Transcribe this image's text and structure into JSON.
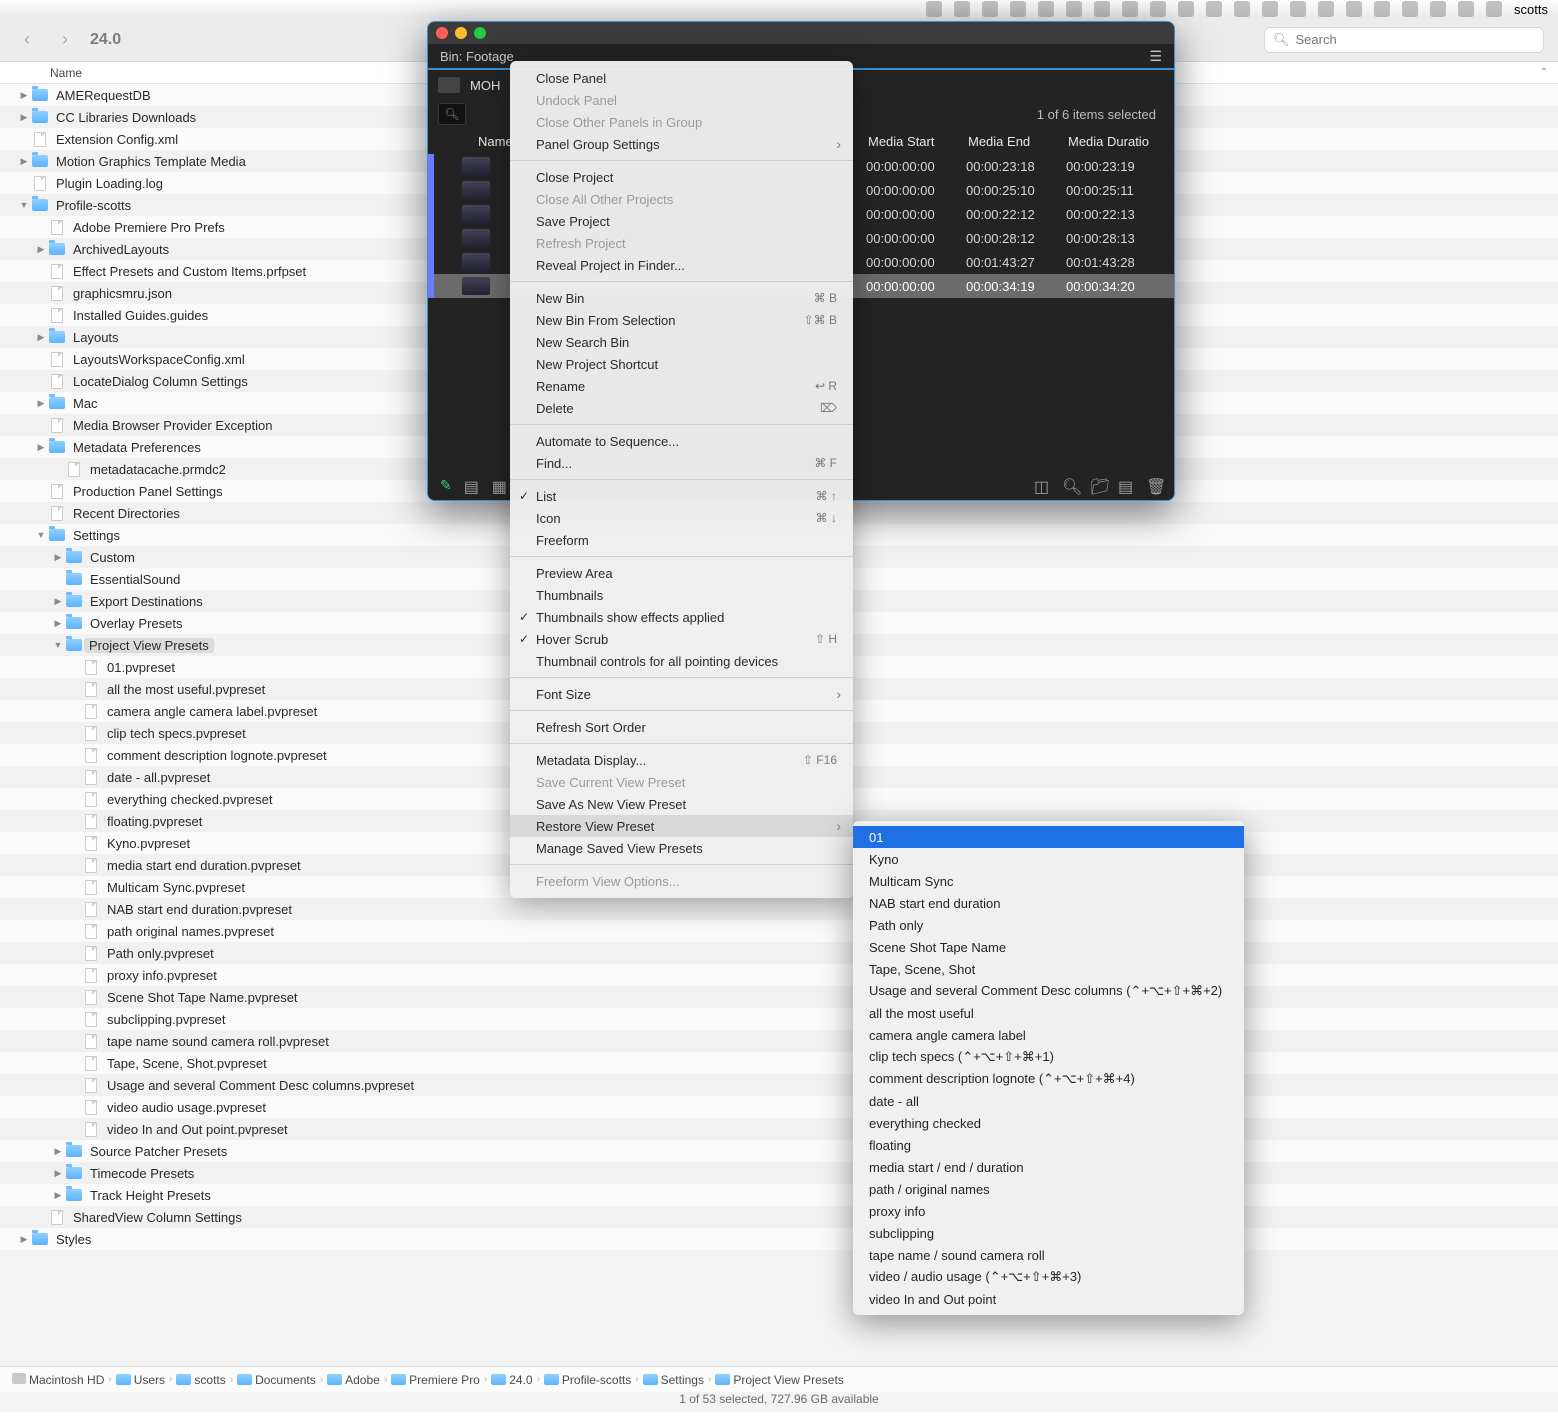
{
  "menubar": {
    "username": "scotts"
  },
  "toolbar": {
    "title": "24.0",
    "search_placeholder": "Search"
  },
  "column_header": "Name",
  "tree": [
    {
      "d": 0,
      "t": "folder",
      "a": "right",
      "label": "AMERequestDB"
    },
    {
      "d": 0,
      "t": "folder",
      "a": "right",
      "label": "CC Libraries Downloads"
    },
    {
      "d": 0,
      "t": "file",
      "label": "Extension Config.xml"
    },
    {
      "d": 0,
      "t": "folder",
      "a": "right",
      "label": "Motion Graphics Template Media"
    },
    {
      "d": 0,
      "t": "file",
      "label": "Plugin Loading.log"
    },
    {
      "d": 0,
      "t": "folder",
      "a": "down",
      "label": "Profile-scotts"
    },
    {
      "d": 1,
      "t": "file",
      "label": "Adobe Premiere Pro Prefs"
    },
    {
      "d": 1,
      "t": "folder",
      "a": "right",
      "label": "ArchivedLayouts"
    },
    {
      "d": 1,
      "t": "file",
      "label": "Effect Presets and Custom Items.prfpset"
    },
    {
      "d": 1,
      "t": "file",
      "label": "graphicsmru.json"
    },
    {
      "d": 1,
      "t": "file",
      "label": "Installed Guides.guides"
    },
    {
      "d": 1,
      "t": "folder",
      "a": "right",
      "label": "Layouts"
    },
    {
      "d": 1,
      "t": "file",
      "label": "LayoutsWorkspaceConfig.xml"
    },
    {
      "d": 1,
      "t": "file",
      "label": "LocateDialog Column Settings"
    },
    {
      "d": 1,
      "t": "folder",
      "a": "right",
      "label": "Mac"
    },
    {
      "d": 1,
      "t": "file",
      "label": "Media Browser Provider Exception"
    },
    {
      "d": 1,
      "t": "folder",
      "a": "right",
      "label": "Metadata Preferences"
    },
    {
      "d": 2,
      "t": "file",
      "label": "metadatacache.prmdc2"
    },
    {
      "d": 1,
      "t": "file",
      "label": "Production Panel Settings"
    },
    {
      "d": 1,
      "t": "file",
      "label": "Recent Directories"
    },
    {
      "d": 1,
      "t": "folder",
      "a": "down",
      "label": "Settings"
    },
    {
      "d": 2,
      "t": "folder",
      "a": "right",
      "label": "Custom"
    },
    {
      "d": 2,
      "t": "folder",
      "label": "EssentialSound"
    },
    {
      "d": 2,
      "t": "folder",
      "a": "right",
      "label": "Export Destinations"
    },
    {
      "d": 2,
      "t": "folder",
      "a": "right",
      "label": "Overlay Presets"
    },
    {
      "d": 2,
      "t": "folder",
      "a": "down",
      "label": "Project View Presets",
      "sel": true
    },
    {
      "d": 3,
      "t": "file",
      "label": "01.pvpreset"
    },
    {
      "d": 3,
      "t": "file",
      "label": "all the most useful.pvpreset"
    },
    {
      "d": 3,
      "t": "file",
      "label": "camera angle camera label.pvpreset"
    },
    {
      "d": 3,
      "t": "file",
      "label": "clip tech specs.pvpreset"
    },
    {
      "d": 3,
      "t": "file",
      "label": "comment description lognote.pvpreset"
    },
    {
      "d": 3,
      "t": "file",
      "label": "date - all.pvpreset"
    },
    {
      "d": 3,
      "t": "file",
      "label": "everything checked.pvpreset"
    },
    {
      "d": 3,
      "t": "file",
      "label": "floating.pvpreset"
    },
    {
      "d": 3,
      "t": "file",
      "label": "Kyno.pvpreset"
    },
    {
      "d": 3,
      "t": "file",
      "label": "media start  end  duration.pvpreset"
    },
    {
      "d": 3,
      "t": "file",
      "label": "Multicam Sync.pvpreset"
    },
    {
      "d": 3,
      "t": "file",
      "label": "NAB start end duration.pvpreset"
    },
    {
      "d": 3,
      "t": "file",
      "label": "path  original names.pvpreset"
    },
    {
      "d": 3,
      "t": "file",
      "label": "Path only.pvpreset"
    },
    {
      "d": 3,
      "t": "file",
      "label": "proxy info.pvpreset"
    },
    {
      "d": 3,
      "t": "file",
      "label": "Scene Shot Tape Name.pvpreset"
    },
    {
      "d": 3,
      "t": "file",
      "label": "subclipping.pvpreset"
    },
    {
      "d": 3,
      "t": "file",
      "label": "tape name  sound camera roll.pvpreset"
    },
    {
      "d": 3,
      "t": "file",
      "label": "Tape, Scene, Shot.pvpreset"
    },
    {
      "d": 3,
      "t": "file",
      "label": "Usage and several Comment Desc columns.pvpreset"
    },
    {
      "d": 3,
      "t": "file",
      "label": "video  audio usage.pvpreset"
    },
    {
      "d": 3,
      "t": "file",
      "label": "video In and Out point.pvpreset"
    },
    {
      "d": 2,
      "t": "folder",
      "a": "right",
      "label": "Source Patcher Presets"
    },
    {
      "d": 2,
      "t": "folder",
      "a": "right",
      "label": "Timecode Presets"
    },
    {
      "d": 2,
      "t": "folder",
      "a": "right",
      "label": "Track Height Presets"
    },
    {
      "d": 1,
      "t": "file",
      "label": "SharedView Column Settings"
    },
    {
      "d": 0,
      "t": "folder",
      "a": "right",
      "label": "Styles"
    }
  ],
  "path": [
    "Macintosh HD",
    "Users",
    "scotts",
    "Documents",
    "Adobe",
    "Premiere Pro",
    "24.0",
    "Profile-scotts",
    "Settings",
    "Project View Presets"
  ],
  "status": "1 of 53 selected, 727.96 GB available",
  "premiere": {
    "tab_label": "Bin: Footage",
    "project_name": "MOH",
    "selection_info": "1 of 6 items selected",
    "cols": [
      "Name",
      "Media Start",
      "Media End",
      "Media Duratio"
    ],
    "rows": [
      {
        "start": "00:00:00:00",
        "end": "00:00:23:18",
        "dur": "00:00:23:19"
      },
      {
        "start": "00:00:00:00",
        "end": "00:00:25:10",
        "dur": "00:00:25:11"
      },
      {
        "start": "00:00:00:00",
        "end": "00:00:22:12",
        "dur": "00:00:22:13"
      },
      {
        "start": "00:00:00:00",
        "end": "00:00:28:12",
        "dur": "00:00:28:13"
      },
      {
        "start": "00:00:00:00",
        "end": "00:01:43:27",
        "dur": "00:01:43:28"
      },
      {
        "start": "00:00:00:00",
        "end": "00:00:34:19",
        "dur": "00:00:34:20",
        "sel": true
      }
    ]
  },
  "ctx": [
    {
      "label": "Close Panel"
    },
    {
      "label": "Undock Panel",
      "dis": true
    },
    {
      "label": "Close Other Panels in Group",
      "dis": true
    },
    {
      "label": "Panel Group Settings",
      "sub": true
    },
    {
      "sep": true
    },
    {
      "label": "Close Project"
    },
    {
      "label": "Close All Other Projects",
      "dis": true
    },
    {
      "label": "Save Project"
    },
    {
      "label": "Refresh Project",
      "dis": true
    },
    {
      "label": "Reveal Project in Finder..."
    },
    {
      "sep": true
    },
    {
      "label": "New Bin",
      "sc": "⌘ B"
    },
    {
      "label": "New Bin From Selection",
      "sc": "⇧⌘ B"
    },
    {
      "label": "New Search Bin"
    },
    {
      "label": "New Project Shortcut"
    },
    {
      "label": "Rename",
      "sc": "↩︎ R"
    },
    {
      "label": "Delete",
      "sc": "⌦"
    },
    {
      "sep": true
    },
    {
      "label": "Automate to Sequence..."
    },
    {
      "label": "Find...",
      "sc": "⌘ F"
    },
    {
      "sep": true
    },
    {
      "label": "List",
      "chk": true,
      "sc": "⌘ ↑"
    },
    {
      "label": "Icon",
      "sc": "⌘ ↓"
    },
    {
      "label": "Freeform"
    },
    {
      "sep": true
    },
    {
      "label": "Preview Area"
    },
    {
      "label": "Thumbnails"
    },
    {
      "label": "Thumbnails show effects applied",
      "chk": true
    },
    {
      "label": "Hover Scrub",
      "chk": true,
      "sc": "⇧ H"
    },
    {
      "label": "Thumbnail controls for all pointing devices"
    },
    {
      "sep": true
    },
    {
      "label": "Font Size",
      "sub": true
    },
    {
      "sep": true
    },
    {
      "label": "Refresh Sort Order"
    },
    {
      "sep": true
    },
    {
      "label": "Metadata Display...",
      "sc": "⇧ F16"
    },
    {
      "label": "Save Current View Preset",
      "dis": true
    },
    {
      "label": "Save As New View Preset"
    },
    {
      "label": "Restore View Preset",
      "sub": true,
      "hl": true
    },
    {
      "label": "Manage Saved View Presets"
    },
    {
      "sep": true
    },
    {
      "label": "Freeform View Options...",
      "dis": true
    }
  ],
  "submenu": [
    {
      "label": "01",
      "sel": true
    },
    {
      "label": "Kyno"
    },
    {
      "label": "Multicam Sync"
    },
    {
      "label": "NAB start end duration"
    },
    {
      "label": "Path only"
    },
    {
      "label": "Scene Shot Tape Name"
    },
    {
      "label": "Tape, Scene, Shot"
    },
    {
      "label": "Usage and several Comment Desc columns (⌃+⌥+⇧+⌘+2)"
    },
    {
      "label": "all the most useful"
    },
    {
      "label": "camera angle camera label"
    },
    {
      "label": "clip tech specs (⌃+⌥+⇧+⌘+1)"
    },
    {
      "label": "comment description lognote (⌃+⌥+⇧+⌘+4)"
    },
    {
      "label": "date - all"
    },
    {
      "label": "everything checked"
    },
    {
      "label": "floating"
    },
    {
      "label": "media start / end / duration"
    },
    {
      "label": "path / original names"
    },
    {
      "label": "proxy info"
    },
    {
      "label": "subclipping"
    },
    {
      "label": "tape name / sound camera roll"
    },
    {
      "label": "video / audio usage (⌃+⌥+⇧+⌘+3)"
    },
    {
      "label": "video In and Out point"
    }
  ]
}
